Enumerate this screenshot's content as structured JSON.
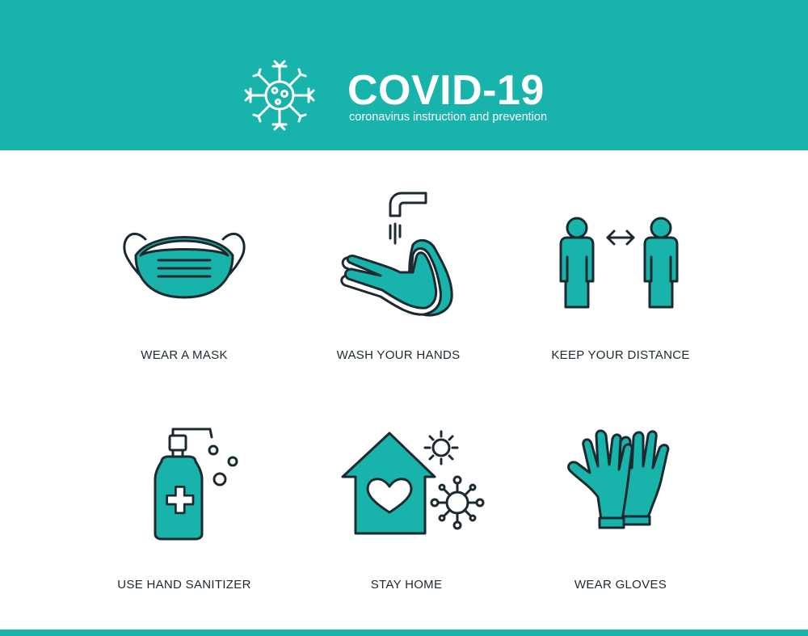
{
  "header": {
    "title": "COVID-19",
    "subtitle": "coronavirus instruction and prevention",
    "logo_icon": "coronavirus-icon"
  },
  "colors": {
    "accent": "#18b3ab",
    "ink": "#1c2a30",
    "background": "#ffffff"
  },
  "items": [
    {
      "label": "WEAR A MASK",
      "icon": "face-mask-icon"
    },
    {
      "label": "WASH YOUR HANDS",
      "icon": "hand-washing-icon"
    },
    {
      "label": "KEEP YOUR DISTANCE",
      "icon": "social-distance-icon"
    },
    {
      "label": "USE HAND SANITIZER",
      "icon": "hand-sanitizer-icon"
    },
    {
      "label": "STAY HOME",
      "icon": "stay-home-icon"
    },
    {
      "label": "WEAR GLOVES",
      "icon": "gloves-icon"
    }
  ]
}
